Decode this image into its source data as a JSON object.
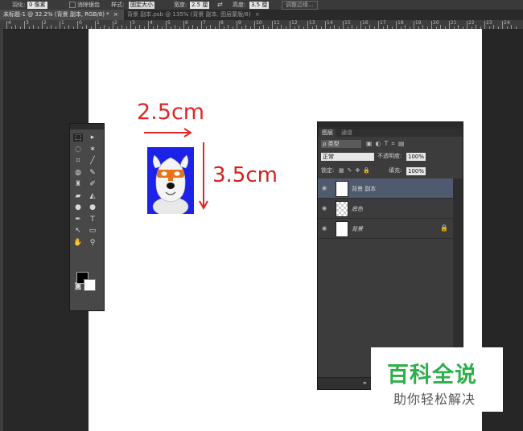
{
  "options_bar": {
    "feather_label": "羽化:",
    "feather_value": "0 像素",
    "antialias_label": "消除锯齿",
    "style_label": "样式:",
    "style_value": "固定大小",
    "width_label": "宽度:",
    "width_value": "2.5 厘",
    "swap_icon": "swap-arrows-icon",
    "height_label": "高度:",
    "height_value": "3.5 厘",
    "refine_edge_label": "调整边缘..."
  },
  "doc_tabs": [
    {
      "label": "未标题-1 @ 32.2% (背景 副本, RGB/8) *",
      "close": "×",
      "active": true
    },
    {
      "label": "背景 副本.psb @ 135% (背景 副本, 图层蒙版/8)",
      "close": "×",
      "active": false
    }
  ],
  "ruler": {
    "labels": [
      "4",
      "3",
      "2",
      "1",
      "0",
      "1",
      "2",
      "3",
      "4",
      "5",
      "6",
      "7",
      "8",
      "9",
      "10",
      "11",
      "12",
      "13",
      "14",
      "15",
      "16",
      "17",
      "18",
      "19",
      "20",
      "21",
      "22",
      "23",
      "24"
    ]
  },
  "annotations": {
    "width_dimension": "2.5cm",
    "height_dimension": "3.5cm",
    "arrow_color": "#e02727"
  },
  "photo": {
    "background_color": "#1c22e8",
    "mask_color": "#e8731c"
  },
  "toolbox": {
    "tools": [
      {
        "name": "marquee-icon",
        "glyph": "⬚"
      },
      {
        "name": "move-icon",
        "glyph": "▸"
      },
      {
        "name": "lasso-icon",
        "glyph": "◌"
      },
      {
        "name": "magic-wand-icon",
        "glyph": "✶"
      },
      {
        "name": "crop-icon",
        "glyph": "⌗"
      },
      {
        "name": "eyedropper-icon",
        "glyph": "╱"
      },
      {
        "name": "healing-brush-icon",
        "glyph": "◍"
      },
      {
        "name": "brush-icon",
        "glyph": "✎"
      },
      {
        "name": "clone-stamp-icon",
        "glyph": "♜"
      },
      {
        "name": "history-brush-icon",
        "glyph": "✐"
      },
      {
        "name": "eraser-icon",
        "glyph": "▰"
      },
      {
        "name": "paint-bucket-icon",
        "glyph": "◭"
      },
      {
        "name": "blur-icon",
        "glyph": "●"
      },
      {
        "name": "dodge-icon",
        "glyph": "●"
      },
      {
        "name": "pen-icon",
        "glyph": "✒"
      },
      {
        "name": "type-icon",
        "glyph": "T"
      },
      {
        "name": "path-selection-icon",
        "glyph": "↖"
      },
      {
        "name": "shape-icon",
        "glyph": "▭"
      },
      {
        "name": "hand-icon",
        "glyph": "✋"
      },
      {
        "name": "zoom-icon",
        "glyph": "⚲"
      },
      {
        "name": "quick-mask-icon",
        "glyph": "◙"
      },
      {
        "name": "screen-mode-icon",
        "glyph": "▣"
      }
    ],
    "foreground_color": "#000000",
    "background_color": "#ffffff"
  },
  "layers_panel": {
    "tab_layers": "图层",
    "tab_channels": "通道",
    "filter_kind": "ρ 类型",
    "blend_mode": "正常",
    "opacity_label": "不透明度:",
    "opacity_value": "100%",
    "lock_label": "锁定:",
    "fill_label": "填充:",
    "fill_value": "100%",
    "layers": [
      {
        "name": "背景 副本",
        "thumb": "white-linked",
        "selected": true
      },
      {
        "name": "底色",
        "thumb": "transparent",
        "selected": false
      },
      {
        "name": "背景",
        "thumb": "white",
        "selected": false,
        "locked": true
      }
    ],
    "eye_icon": "◉",
    "lock_icon": "🔒",
    "link_icon": "⚭"
  },
  "watermark": {
    "title": "百科全说",
    "subtitle": "助你轻松解决",
    "title_color": "#2bb04a"
  }
}
